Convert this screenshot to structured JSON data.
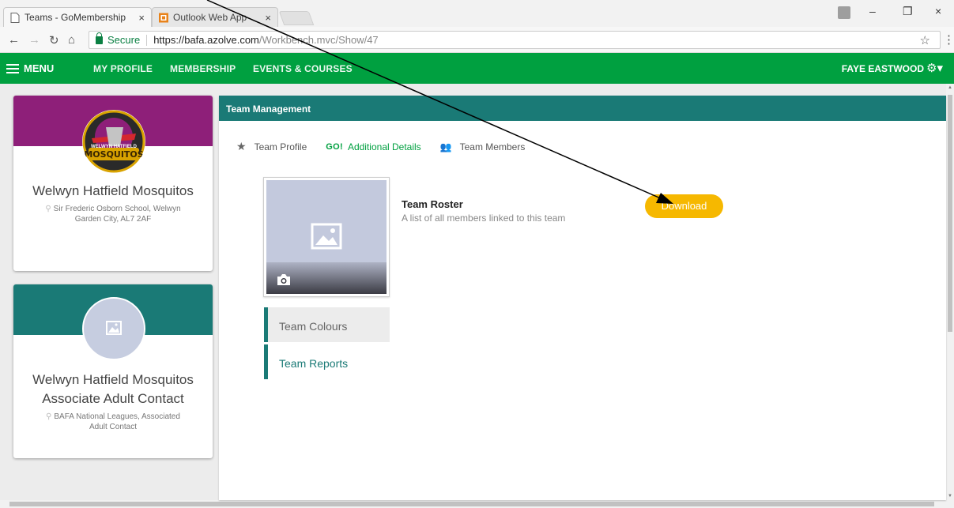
{
  "browser": {
    "tabs": [
      {
        "title": "Teams - GoMembership",
        "close": "×",
        "active": true
      },
      {
        "title": "Outlook Web App",
        "close": "×",
        "active": false
      }
    ],
    "window_controls": {
      "minimize": "–",
      "restore": "❐",
      "close": "×"
    },
    "address": {
      "secure_label": "Secure",
      "url_host": "https://bafa.azolve.com",
      "url_path": "/Workbench.mvc/Show/47"
    }
  },
  "nav": {
    "menu_label": "MENU",
    "links": [
      "MY PROFILE",
      "MEMBERSHIP",
      "EVENTS & COURSES"
    ],
    "user_name": "FAYE EASTWOOD"
  },
  "cards": [
    {
      "title": "Welwyn Hatfield Mosquitos",
      "address": "Sir Frederic Osborn School, Welwyn Garden City, AL7 2AF",
      "logo_text": "MOSQUITOS",
      "logo_subtext": "WELWYN HATFIELD"
    },
    {
      "title": "Welwyn Hatfield Mosquitos Associate Adult Contact",
      "address": "BAFA National Leagues, Associated Adult Contact"
    }
  ],
  "panel": {
    "header": "Team Management",
    "subtabs": [
      {
        "label": "Team Profile",
        "icon": "star-icon"
      },
      {
        "label": "Additional Details",
        "icon": "go-icon",
        "icon_text": "GO!"
      },
      {
        "label": "Team Members",
        "icon": "people-icon"
      }
    ],
    "side_menu": [
      "Team Colours",
      "Team Reports"
    ],
    "roster": {
      "title": "Team Roster",
      "description": "A list of all members linked to this team",
      "button_label": "Download"
    }
  },
  "colors": {
    "nav_green": "#00a040",
    "teal": "#1a7a76",
    "purple": "#8e1f79",
    "button_yellow": "#f6b800"
  }
}
